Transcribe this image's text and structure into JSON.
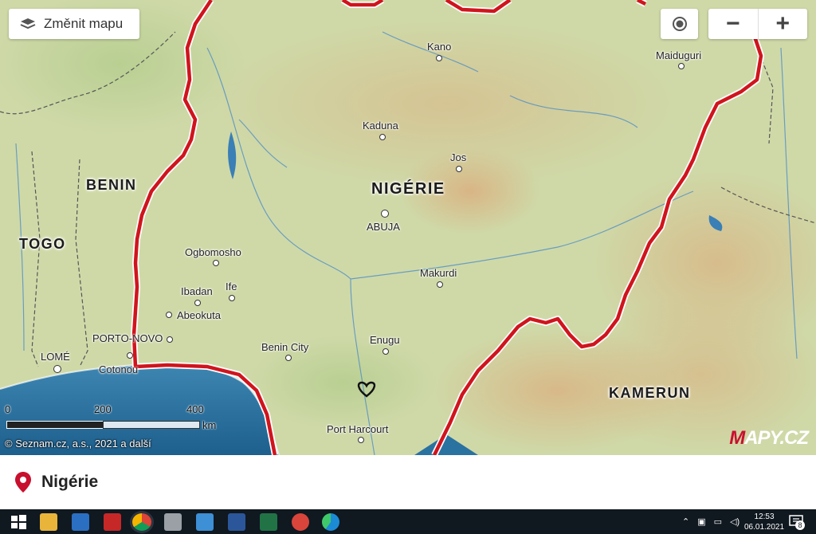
{
  "map_controls": {
    "switch_map_label": "Změnit mapu",
    "locate_icon": "target-icon",
    "zoom_out": "−",
    "zoom_in": "+"
  },
  "countries": {
    "nigeria": "NIGÉRIE",
    "benin": "BENIN",
    "togo": "TOGO",
    "cameroon": "KAMERUN"
  },
  "cities": {
    "kano": "Kano",
    "maiduguri": "Maiduguri",
    "kaduna": "Kaduna",
    "jos": "Jos",
    "abuja": "ABUJA",
    "ogbomosho": "Ogbomosho",
    "ibadan": "Ibadan",
    "ife": "Ife",
    "abeokuta": "Abeokuta",
    "porto_novo": "PORTO-NOVO",
    "lome": "LOMÉ",
    "cotonou": "Cotonou",
    "benin_city": "Benin City",
    "makurdi": "Makurdi",
    "enugu": "Enugu",
    "port_harcourt": "Port Harcourt"
  },
  "scale": {
    "ticks": [
      "0",
      "200",
      "400"
    ],
    "unit": "km"
  },
  "attribution": "© Seznam.cz, a.s., 2021 a další",
  "logo": {
    "first": "M",
    "rest": "APY.CZ"
  },
  "info_panel": {
    "title": "Nigérie"
  },
  "taskbar": {
    "time": "12:53",
    "date": "06.01.2021",
    "notifications": "8"
  },
  "colors": {
    "border": "#d0141d",
    "sea": "#2a72a0",
    "land": "#cfd9a8",
    "marker": "#c8102e"
  }
}
